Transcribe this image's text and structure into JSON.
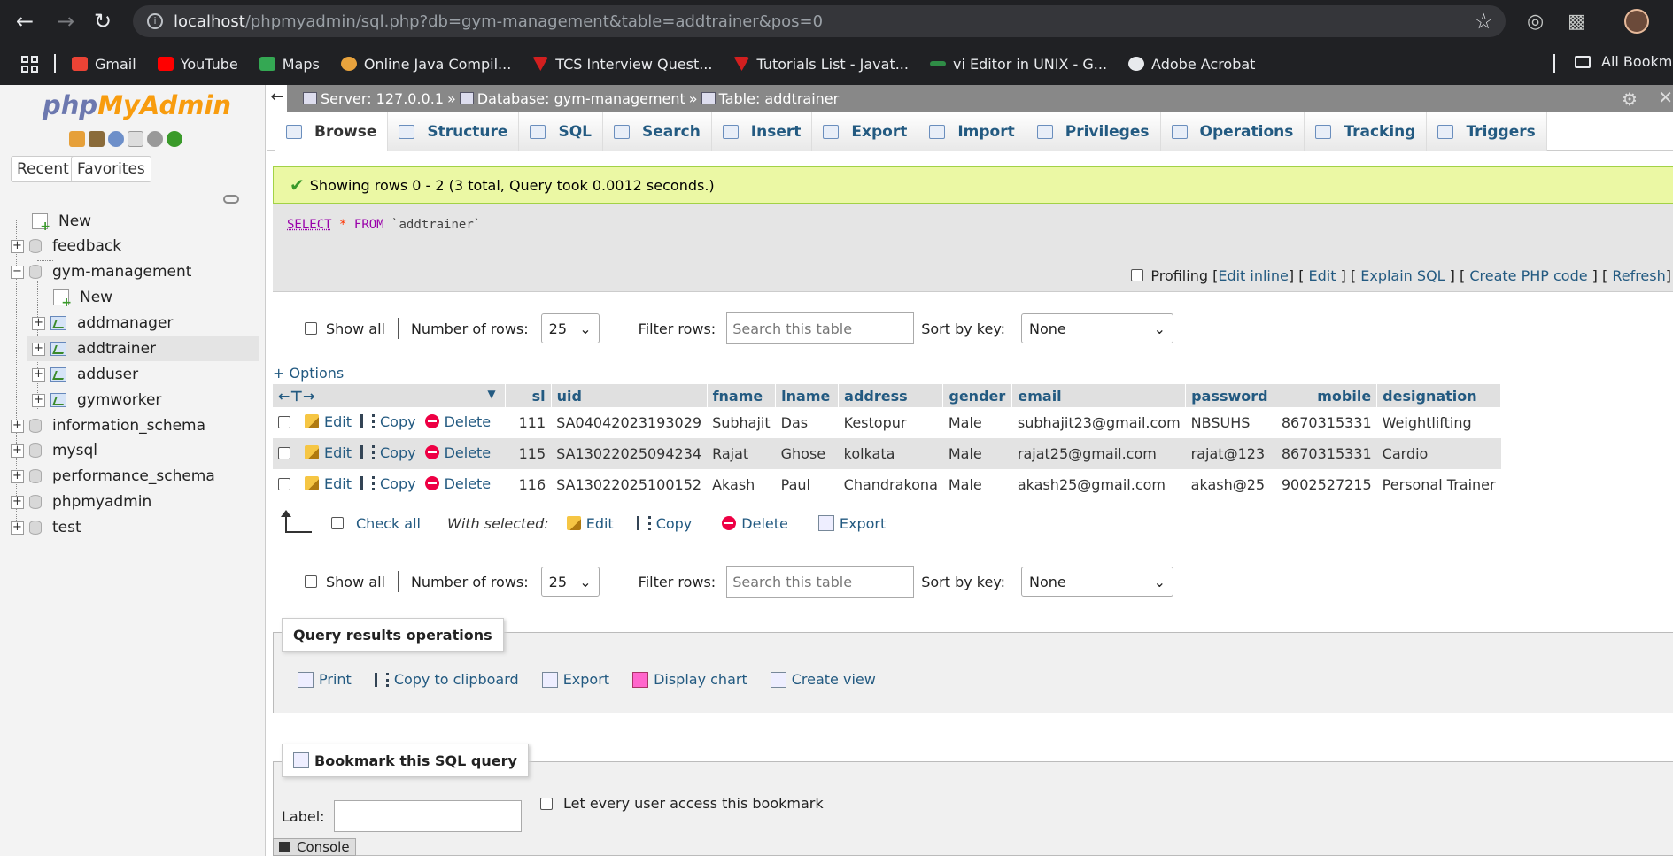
{
  "browser": {
    "url_host": "localhost",
    "url_path": "/phpmyadmin/sql.php?db=gym-management&table=addtrainer&pos=0",
    "bookmarks": [
      {
        "label": "Gmail",
        "color": "#ea4335"
      },
      {
        "label": "YouTube",
        "color": "#ff0000"
      },
      {
        "label": "Maps",
        "color": "#34a853"
      },
      {
        "label": "Online Java Compil...",
        "color": "#e8a33d"
      },
      {
        "label": "TCS Interview Quest...",
        "color": "#d21f1f"
      },
      {
        "label": "Tutorials List - Javat...",
        "color": "#d21f1f"
      },
      {
        "label": "vi Editor in UNIX - G...",
        "color": "#2f8d46"
      },
      {
        "label": "Adobe Acrobat",
        "color": "#e8eaed"
      }
    ],
    "all_bookmarks": "All Bookmar"
  },
  "sidebar": {
    "logo_part1": "php",
    "logo_part2": "MyAdmin",
    "recent": "Recent",
    "favorites": "Favorites",
    "tree": {
      "new_root": "New",
      "feedback": "feedback",
      "gym": "gym-management",
      "gym_new": "New",
      "addmanager": "addmanager",
      "addtrainer": "addtrainer",
      "adduser": "adduser",
      "gymworker": "gymworker",
      "information_schema": "information_schema",
      "mysql": "mysql",
      "performance_schema": "performance_schema",
      "phpmyadmin": "phpmyadmin",
      "test": "test"
    }
  },
  "breadcrumb": {
    "server": "Server: 127.0.0.1",
    "database": "Database: gym-management",
    "table": "Table: addtrainer",
    "sep": "»"
  },
  "tabs": [
    "Browse",
    "Structure",
    "SQL",
    "Search",
    "Insert",
    "Export",
    "Import",
    "Privileges",
    "Operations",
    "Tracking",
    "Triggers"
  ],
  "success_message": "Showing rows 0 - 2 (3 total, Query took 0.0012 seconds.)",
  "sql": {
    "select": "SELECT",
    "star": "*",
    "from": "FROM",
    "table": "`addtrainer`"
  },
  "sql_links": {
    "profiling": "Profiling",
    "edit_inline": "Edit inline",
    "edit": "Edit",
    "explain": "Explain SQL",
    "php": "Create PHP code",
    "refresh": "Refresh"
  },
  "nav": {
    "show_all": "Show all",
    "num_rows_label": "Number of rows:",
    "num_rows_value": "25",
    "filter_label": "Filter rows:",
    "filter_placeholder": "Search this table",
    "sort_label": "Sort by key:",
    "sort_value": "None"
  },
  "options_link": "+ Options",
  "table": {
    "columns": [
      "sl",
      "uid",
      "fname",
      "lname",
      "address",
      "gender",
      "email",
      "password",
      "mobile",
      "designation"
    ],
    "actions": {
      "edit": "Edit",
      "copy": "Copy",
      "delete": "Delete"
    },
    "rows": [
      [
        "111",
        "SA04042023193029",
        "Subhajit",
        "Das",
        "Kestopur",
        "Male",
        "subhajit23@gmail.com",
        "NBSUHS",
        "8670315331",
        "Weightlifting"
      ],
      [
        "115",
        "SA13022025094234",
        "Rajat",
        "Ghose",
        "kolkata",
        "Male",
        "rajat25@gmail.com",
        "rajat@123",
        "8670315331",
        "Cardio"
      ],
      [
        "116",
        "SA13022025100152",
        "Akash",
        "Paul",
        "Chandrakona",
        "Male",
        "akash25@gmail.com",
        "akash@25",
        "9002527215",
        "Personal Trainer"
      ]
    ]
  },
  "bulk": {
    "check_all": "Check all",
    "with_selected": "With selected:",
    "edit": "Edit",
    "copy": "Copy",
    "delete": "Delete",
    "export": "Export"
  },
  "qro": {
    "title": "Query results operations",
    "print": "Print",
    "copy": "Copy to clipboard",
    "export": "Export",
    "chart": "Display chart",
    "view": "Create view"
  },
  "bookmark": {
    "title": "Bookmark this SQL query",
    "label": "Label:",
    "every_user": "Let every user access this bookmark"
  },
  "console": "Console"
}
